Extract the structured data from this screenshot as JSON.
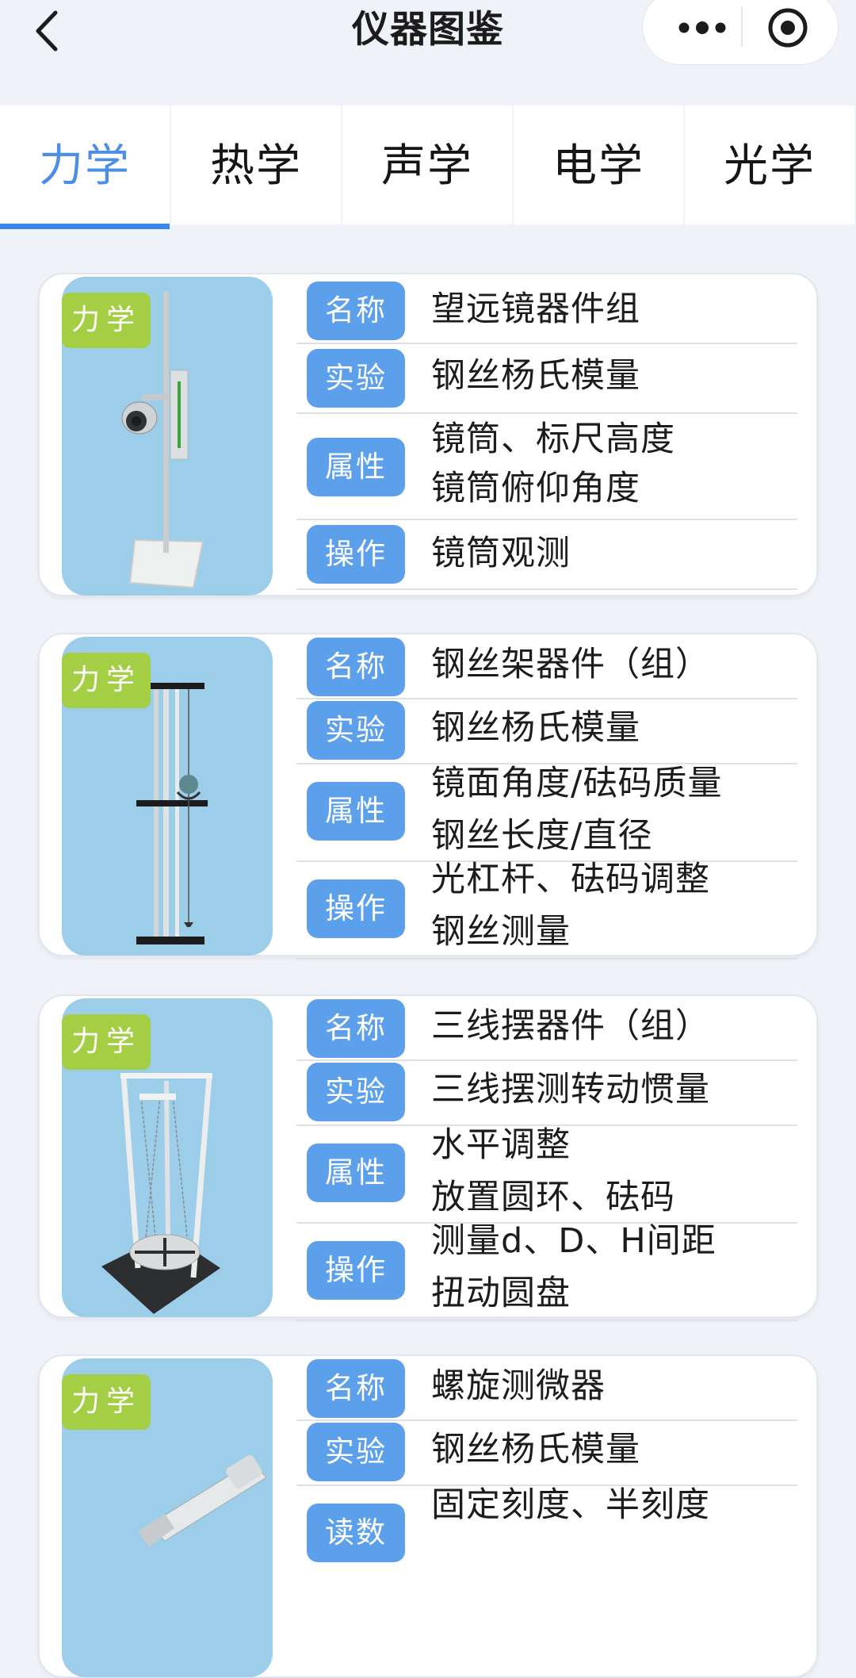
{
  "nav": {
    "title": "仪器图鉴"
  },
  "tabs": [
    {
      "label": "力学"
    },
    {
      "label": "热学"
    },
    {
      "label": "声学"
    },
    {
      "label": "电学"
    },
    {
      "label": "光学"
    }
  ],
  "labels": {
    "name": "名称",
    "experiment": "实验",
    "property": "属性",
    "operation": "操作",
    "reading": "读数"
  },
  "cards": [
    {
      "tag": "力学",
      "name": "望远镜器件组",
      "experiment": "钢丝杨氏模量",
      "property": [
        "镜筒、标尺高度",
        "镜筒俯仰角度"
      ],
      "operation": [
        "镜筒观测"
      ]
    },
    {
      "tag": "力学",
      "name": "钢丝架器件（组）",
      "experiment": "钢丝杨氏模量",
      "property": [
        "镜面角度/砝码质量",
        "钢丝长度/直径"
      ],
      "operation": [
        "光杠杆、砝码调整",
        "钢丝测量"
      ]
    },
    {
      "tag": "力学",
      "name": "三线摆器件（组）",
      "experiment": "三线摆测转动惯量",
      "property": [
        "水平调整",
        "放置圆环、砝码"
      ],
      "operation": [
        "测量d、D、H间距",
        "扭动圆盘"
      ]
    },
    {
      "tag": "力学",
      "name": "螺旋测微器",
      "experiment": "钢丝杨氏模量",
      "reading": [
        "固定刻度、半刻度"
      ]
    }
  ]
}
